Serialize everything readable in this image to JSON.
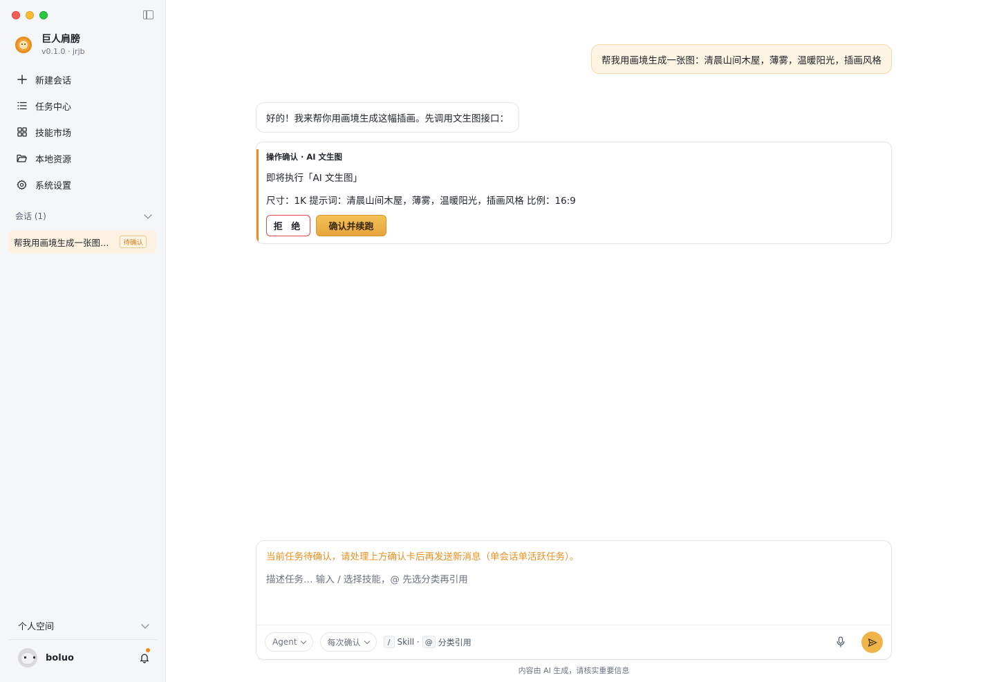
{
  "app": {
    "name": "巨人肩膀",
    "version": "v0.1.0 · jrjb",
    "accent_color": "#e8901f"
  },
  "sidebar": {
    "nav": [
      {
        "label": "新建会话",
        "icon": "plus-icon"
      },
      {
        "label": "任务中心",
        "icon": "list-icon"
      },
      {
        "label": "技能市场",
        "icon": "grid-icon"
      },
      {
        "label": "本地资源",
        "icon": "folder-icon"
      },
      {
        "label": "系统设置",
        "icon": "gear-icon"
      }
    ],
    "sessions_header": "会话 (1)",
    "sessions": [
      {
        "title": "帮我用画境生成一张图…",
        "status": "待确认"
      }
    ],
    "space_label": "个人空间",
    "user": {
      "name": "boluo"
    }
  },
  "conversation": {
    "user_message": "帮我用画境生成一张图：清晨山间木屋，薄雾，温暖阳光，插画风格",
    "assistant_message": "好的！我来帮你用画境生成这幅插画。先调用文生图接口：",
    "confirm_card": {
      "header": "操作确认 · AI 文生图",
      "action": "即将执行「AI 文生图」",
      "detail": "尺寸：1K 提示词：清晨山间木屋，薄雾，温暖阳光，插画风格 比例：16:9",
      "reject_label": "拒 绝",
      "confirm_label": "确认并续跑"
    }
  },
  "composer": {
    "warning": "当前任务待确认，请处理上方确认卡后再发送新消息（单会话单活跃任务）。",
    "placeholder": "描述任务… 输入 / 选择技能，@ 先选分类再引用",
    "mode_label": "Agent",
    "confirm_mode_label": "每次确认",
    "hint_slash": "/",
    "hint_skill": "Skill ·",
    "hint_at": "@",
    "hint_ref": "分类引用"
  },
  "footer": {
    "note": "内容由 AI 生成，请核实重要信息"
  }
}
